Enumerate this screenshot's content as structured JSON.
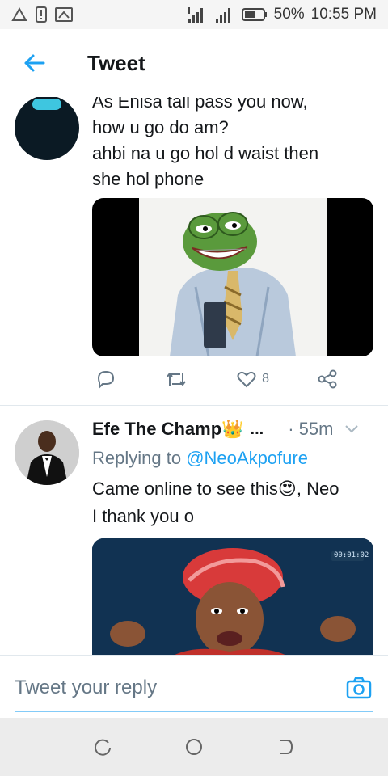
{
  "status_bar": {
    "battery": "50%",
    "time": "10:55 PM"
  },
  "header": {
    "title": "Tweet"
  },
  "tweets": [
    {
      "text_lines": [
        "As Enisa tall pass you now,",
        "how u go do am?",
        "ahbi na u go hol d waist then",
        "she hol phone"
      ],
      "like_count": "8"
    },
    {
      "display_name": "Efe The Champ",
      "name_emoji": "👑",
      "ellipsis": "...",
      "time": "· 55m",
      "replying_prefix": "Replying to",
      "replying_handle": "@NeoAkpofure",
      "text_line1_before": "Came online to see this",
      "text_emoji": "😍",
      "text_line1_after": ", Neo",
      "text_line2": "I thank you o",
      "media_timestamp": "00:01:02"
    }
  ],
  "composer": {
    "placeholder": "Tweet your reply"
  },
  "colors": {
    "accent": "#1da1f2",
    "muted": "#657786",
    "text": "#14171a"
  }
}
